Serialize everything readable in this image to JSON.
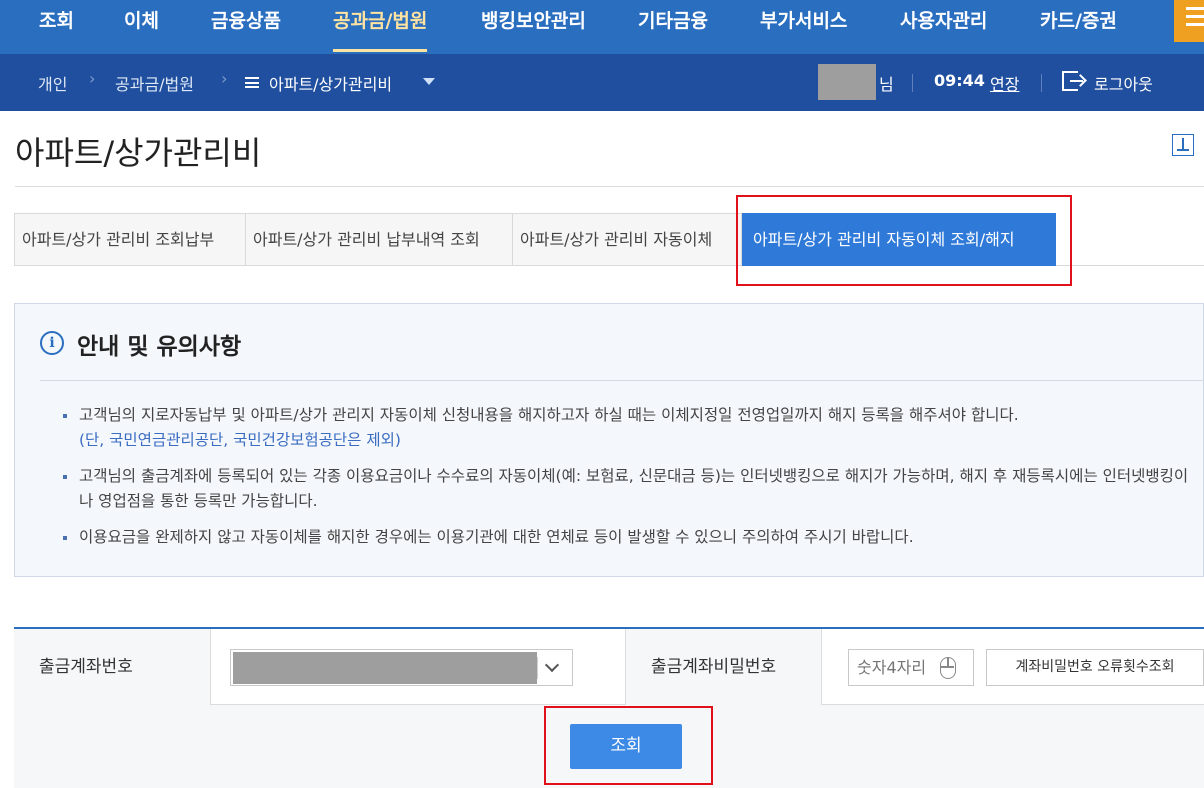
{
  "topnav": {
    "items": [
      "조회",
      "이체",
      "금융상품",
      "공과금/법원",
      "뱅킹보안관리",
      "기타금융",
      "부가서비스",
      "사용자관리",
      "카드/증권"
    ]
  },
  "breadcrumb": {
    "home": "개인",
    "level1": "공과금/법원",
    "current": "아파트/상가관리비"
  },
  "session": {
    "suffix": "님",
    "time": "09:44",
    "extend": "연장",
    "logout": "로그아웃"
  },
  "page": {
    "title": "아파트/상가관리비"
  },
  "tabs": [
    "아파트/상가 관리비 조회납부",
    "아파트/상가 관리비 납부내역 조회",
    "아파트/상가 관리비 자동이체",
    "아파트/상가 관리비 자동이체 조회/해지"
  ],
  "notice": {
    "title": "안내 및 유의사항",
    "items": [
      {
        "text": "고객님의 지로자동납부 및 아파트/상가 관리지 자동이체 신청내용을 해지하고자 하실 때는 이체지정일 전영업일까지 해지 등록을 해주셔야 합니다.",
        "sub": "(단, 국민연금관리공단, 국민건강보험공단은 제외)"
      },
      {
        "text": "고객님의 출금계좌에 등록되어 있는 각종 이용요금이나 수수료의 자동이체(예: 보험료, 신문대금 등)는 인터넷뱅킹으로 해지가 가능하며, 해지 후 재등록시에는 인터넷뱅킹이나 영업점을 통한 등록만 가능합니다."
      },
      {
        "text": "이용요금을 완제하지 않고 자동이체를 해지한 경우에는 이용기관에 대한 연체료 등이 발생할 수 있으니 주의하여 주시기 바랍니다."
      }
    ]
  },
  "form": {
    "account_label": "출금계좌번호",
    "password_label": "출금계좌비밀번호",
    "password_placeholder": "숫자4자리",
    "error_count_button": "계좌비밀번호 오류횟수조회",
    "search_button": "조회"
  },
  "colors": {
    "nav_bg": "#2a6ec0",
    "subbar_bg": "#1f4f9e",
    "active_tab": "#2f7ad8",
    "highlight": "#e0111b",
    "menu_button": "#f0a020"
  }
}
